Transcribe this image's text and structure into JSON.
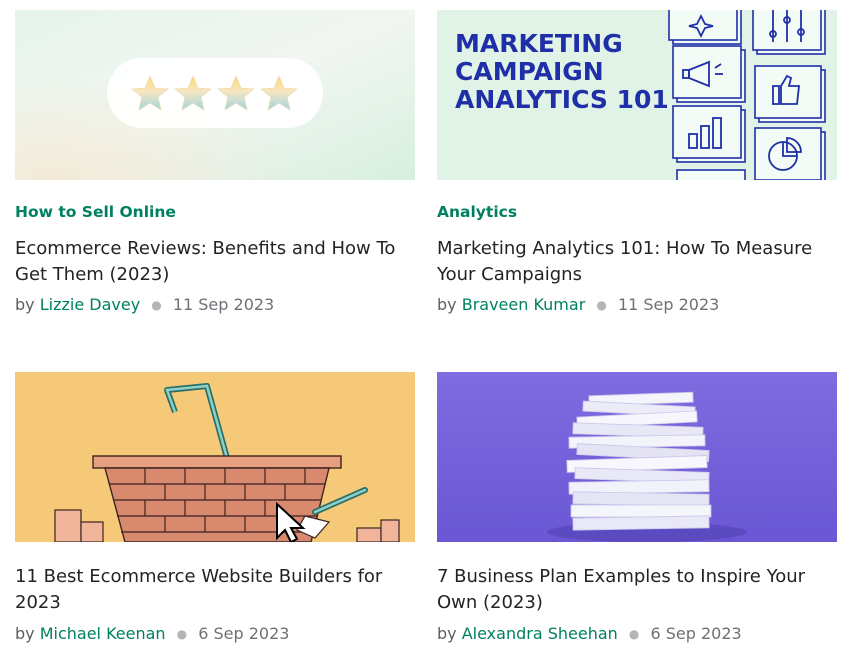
{
  "cards": [
    {
      "category": "How to Sell Online",
      "title": "Ecommerce Reviews: Benefits and How To Get Them (2023)",
      "by": "by",
      "author": "Lizzie Davey",
      "date": "11 Sep 2023",
      "image": "five-star-rating-illustration"
    },
    {
      "category": "Analytics",
      "title": "Marketing Analytics 101: How To Measure Your Campaigns",
      "by": "by",
      "author": "Braveen Kumar",
      "date": "11 Sep 2023",
      "image": "marketing-campaign-analytics-graphic",
      "image_text": [
        "MARKETING",
        "CAMPAIGN",
        "ANALYTICS 101"
      ]
    },
    {
      "category": "",
      "title": "11 Best Ecommerce Website Builders for 2023",
      "by": "by",
      "author": "Michael Keenan",
      "date": "6 Sep 2023",
      "image": "brick-basket-illustration"
    },
    {
      "category": "",
      "title": "7 Business Plan Examples to Inspire Your Own (2023)",
      "by": "by",
      "author": "Alexandra Sheehan",
      "date": "6 Sep 2023",
      "image": "stacked-books-photo"
    }
  ],
  "colors": {
    "accent": "#008060",
    "text": "#212326",
    "muted": "#6d7175",
    "analytics_bg": "#dff3e6",
    "analytics_ink": "#1f2fa8",
    "basket_bg": "#f6c978",
    "brick": "#d98a6e",
    "books_bg": "#7a66dd"
  }
}
